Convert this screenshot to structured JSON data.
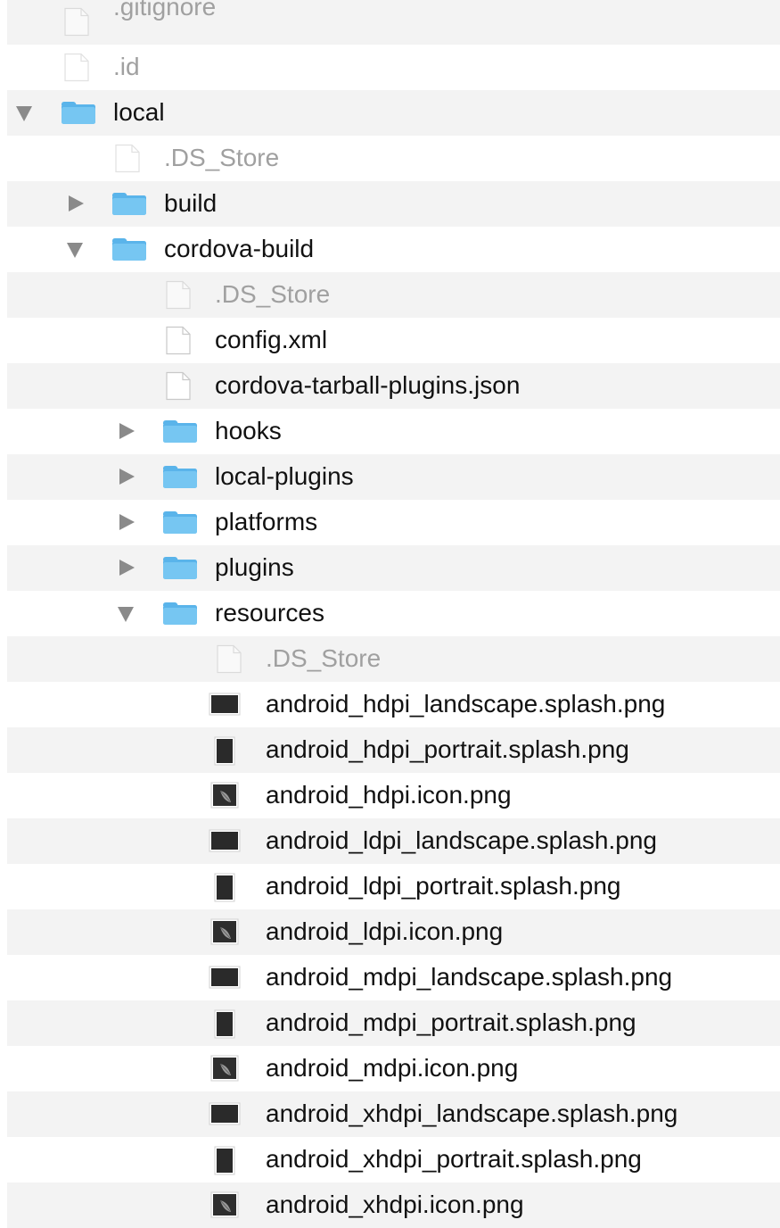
{
  "colors": {
    "folder": "#5ab4ea",
    "folder_tab": "#76c6f2",
    "text": "#111111",
    "dim_text": "#a0a0a0",
    "alt_row": "#f3f3f3"
  },
  "rows": [
    {
      "name": ".gitignore",
      "kind": "file",
      "depth": 1,
      "dim": true,
      "partial": true
    },
    {
      "name": ".id",
      "kind": "file",
      "depth": 1,
      "dim": true
    },
    {
      "name": "local",
      "kind": "folder",
      "depth": 1,
      "expanded": true
    },
    {
      "name": ".DS_Store",
      "kind": "file",
      "depth": 2,
      "dim": true
    },
    {
      "name": "build",
      "kind": "folder",
      "depth": 2,
      "expanded": false
    },
    {
      "name": "cordova-build",
      "kind": "folder",
      "depth": 2,
      "expanded": true
    },
    {
      "name": ".DS_Store",
      "kind": "file",
      "depth": 3,
      "dim": true
    },
    {
      "name": "config.xml",
      "kind": "file",
      "depth": 3
    },
    {
      "name": "cordova-tarball-plugins.json",
      "kind": "file",
      "depth": 3
    },
    {
      "name": "hooks",
      "kind": "folder",
      "depth": 3,
      "expanded": false
    },
    {
      "name": "local-plugins",
      "kind": "folder",
      "depth": 3,
      "expanded": false
    },
    {
      "name": "platforms",
      "kind": "folder",
      "depth": 3,
      "expanded": false
    },
    {
      "name": "plugins",
      "kind": "folder",
      "depth": 3,
      "expanded": false
    },
    {
      "name": "resources",
      "kind": "folder",
      "depth": 3,
      "expanded": true
    },
    {
      "name": ".DS_Store",
      "kind": "file",
      "depth": 4,
      "dim": true
    },
    {
      "name": "android_hdpi_landscape.splash.png",
      "kind": "image-landscape",
      "depth": 4
    },
    {
      "name": "android_hdpi_portrait.splash.png",
      "kind": "image-portrait",
      "depth": 4
    },
    {
      "name": "android_hdpi.icon.png",
      "kind": "image-icon",
      "depth": 4
    },
    {
      "name": "android_ldpi_landscape.splash.png",
      "kind": "image-landscape",
      "depth": 4
    },
    {
      "name": "android_ldpi_portrait.splash.png",
      "kind": "image-portrait",
      "depth": 4
    },
    {
      "name": "android_ldpi.icon.png",
      "kind": "image-icon",
      "depth": 4
    },
    {
      "name": "android_mdpi_landscape.splash.png",
      "kind": "image-landscape",
      "depth": 4
    },
    {
      "name": "android_mdpi_portrait.splash.png",
      "kind": "image-portrait",
      "depth": 4
    },
    {
      "name": "android_mdpi.icon.png",
      "kind": "image-icon",
      "depth": 4
    },
    {
      "name": "android_xhdpi_landscape.splash.png",
      "kind": "image-landscape",
      "depth": 4
    },
    {
      "name": "android_xhdpi_portrait.splash.png",
      "kind": "image-portrait",
      "depth": 4
    },
    {
      "name": "android_xhdpi.icon.png",
      "kind": "image-icon",
      "depth": 4
    }
  ]
}
